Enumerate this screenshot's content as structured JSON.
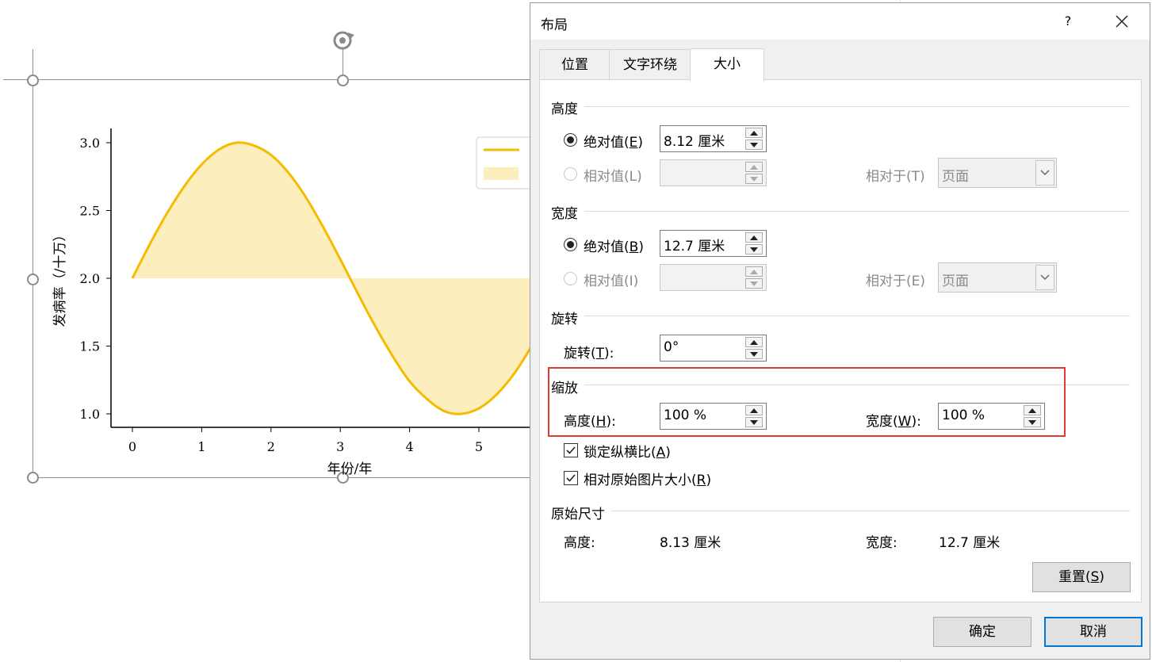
{
  "chart_data": {
    "type": "area",
    "x": [
      0.0,
      0.25,
      0.5,
      0.75,
      1.0,
      1.25,
      1.5,
      1.75,
      2.0,
      2.25,
      2.5,
      2.75,
      3.0,
      3.25,
      3.5,
      3.75,
      4.0,
      4.25,
      4.5,
      4.75,
      5.0,
      5.25,
      5.5,
      5.75,
      6.0
    ],
    "series": [
      {
        "values": [
          2.0,
          2.25,
          2.48,
          2.68,
          2.84,
          2.95,
          3.0,
          2.98,
          2.91,
          2.78,
          2.6,
          2.38,
          2.14,
          1.89,
          1.65,
          1.43,
          1.24,
          1.11,
          1.02,
          1.0,
          1.04,
          1.14,
          1.29,
          1.49,
          1.72
        ],
        "fill_baseline": 2.0
      }
    ],
    "xticks": [
      "0",
      "1",
      "2",
      "3",
      "4",
      "5"
    ],
    "yticks": [
      "1.0",
      "1.5",
      "2.0",
      "2.5",
      "3.0"
    ],
    "xlim": [
      -0.3,
      5.9
    ],
    "ylim": [
      0.95,
      3.1
    ],
    "xlabel": "年份/年",
    "ylabel": "发病率（/十万）",
    "legend": "top-right",
    "colors": {
      "line": "#f5bb00",
      "fill": "#fdeebd"
    }
  },
  "dialog": {
    "title": "布局",
    "help_label": "?",
    "close_icon": "close-icon",
    "tabs": [
      {
        "label": "位置"
      },
      {
        "label": "文字环绕"
      },
      {
        "label": "大小"
      }
    ],
    "active_tab": "大小",
    "height": {
      "section": "高度",
      "absolute_label": "绝对值(",
      "absolute_key": "E",
      "absolute_value": "8.12 厘米",
      "relative_label": "相对值(L)",
      "relative_value": "",
      "relative_to_label": "相对于(T)",
      "relative_to_value": "页面"
    },
    "width": {
      "section": "宽度",
      "absolute_label": "绝对值(",
      "absolute_key": "B",
      "absolute_value": "12.7 厘米",
      "relative_label": "相对值(I)",
      "relative_value": "",
      "relative_to_label": "相对于(E)",
      "relative_to_value": "页面"
    },
    "rotation": {
      "section": "旋转",
      "label_prefix": "旋转(",
      "label_key": "T",
      "label_suffix": "):",
      "value": "0°"
    },
    "scale": {
      "section": "缩放",
      "height_prefix": "高度(",
      "height_key": "H",
      "height_suffix": "):",
      "height_value": "100 %",
      "width_prefix": "宽度(",
      "width_key": "W",
      "width_suffix": "):",
      "width_value": "100 %",
      "lock_prefix": "锁定纵横比(",
      "lock_key": "A",
      "lock_checked": true,
      "relative_prefix": "相对原始图片大小(",
      "relative_key": "R",
      "relative_checked": true
    },
    "original": {
      "section": "原始尺寸",
      "height_label": "高度:",
      "height_value": "8.13 厘米",
      "width_label": "宽度:",
      "width_value": "12.7 厘米"
    },
    "reset_prefix": "重置(",
    "reset_key": "S",
    "ok_label": "确定",
    "cancel_label": "取消"
  }
}
